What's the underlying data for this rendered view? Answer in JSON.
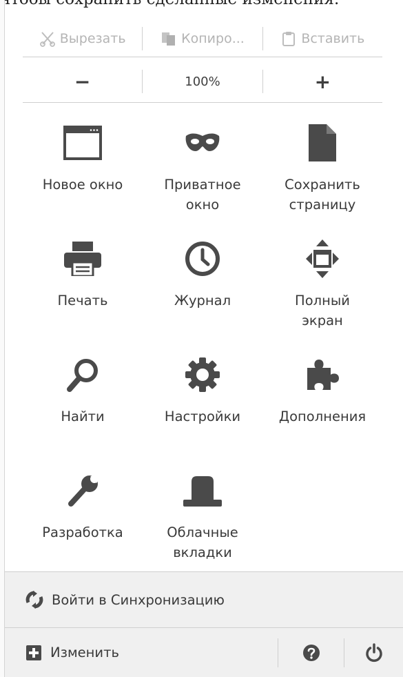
{
  "top_hint": "чтобы сохранить сделанные изменения.",
  "edit_controls": {
    "cut": "Вырезать",
    "copy": "Копиро...",
    "paste": "Вставить"
  },
  "zoom_controls": {
    "minus": "−",
    "level": "100%",
    "plus": "+"
  },
  "grid": [
    {
      "label": "Новое окно",
      "icon": "new-window-icon"
    },
    {
      "label": "Приватное\nокно",
      "icon": "private-mask-icon"
    },
    {
      "label": "Сохранить\nстраницу",
      "icon": "save-page-icon"
    },
    {
      "label": "Печать",
      "icon": "printer-icon"
    },
    {
      "label": "Журнал",
      "icon": "history-clock-icon"
    },
    {
      "label": "Полный\nэкран",
      "icon": "fullscreen-icon"
    },
    {
      "label": "Найти",
      "icon": "search-icon"
    },
    {
      "label": "Настройки",
      "icon": "gear-icon"
    },
    {
      "label": "Дополнения",
      "icon": "puzzle-icon"
    },
    {
      "label": "Разработка",
      "icon": "wrench-icon"
    },
    {
      "label": "Облачные\nвкладки",
      "icon": "cloud-tabs-icon"
    }
  ],
  "sync": {
    "label": "Войти в Синхронизацию",
    "icon": "sync-icon"
  },
  "footer": {
    "customize_label": "Изменить",
    "customize_icon": "plus-box-icon",
    "help_icon": "help-icon",
    "quit_icon": "power-icon"
  },
  "colors": {
    "icon": "#4a4a4a",
    "disabled": "#b4b4b4",
    "footer_bg": "#f0f0f0",
    "separator": "#cfcfcf"
  }
}
